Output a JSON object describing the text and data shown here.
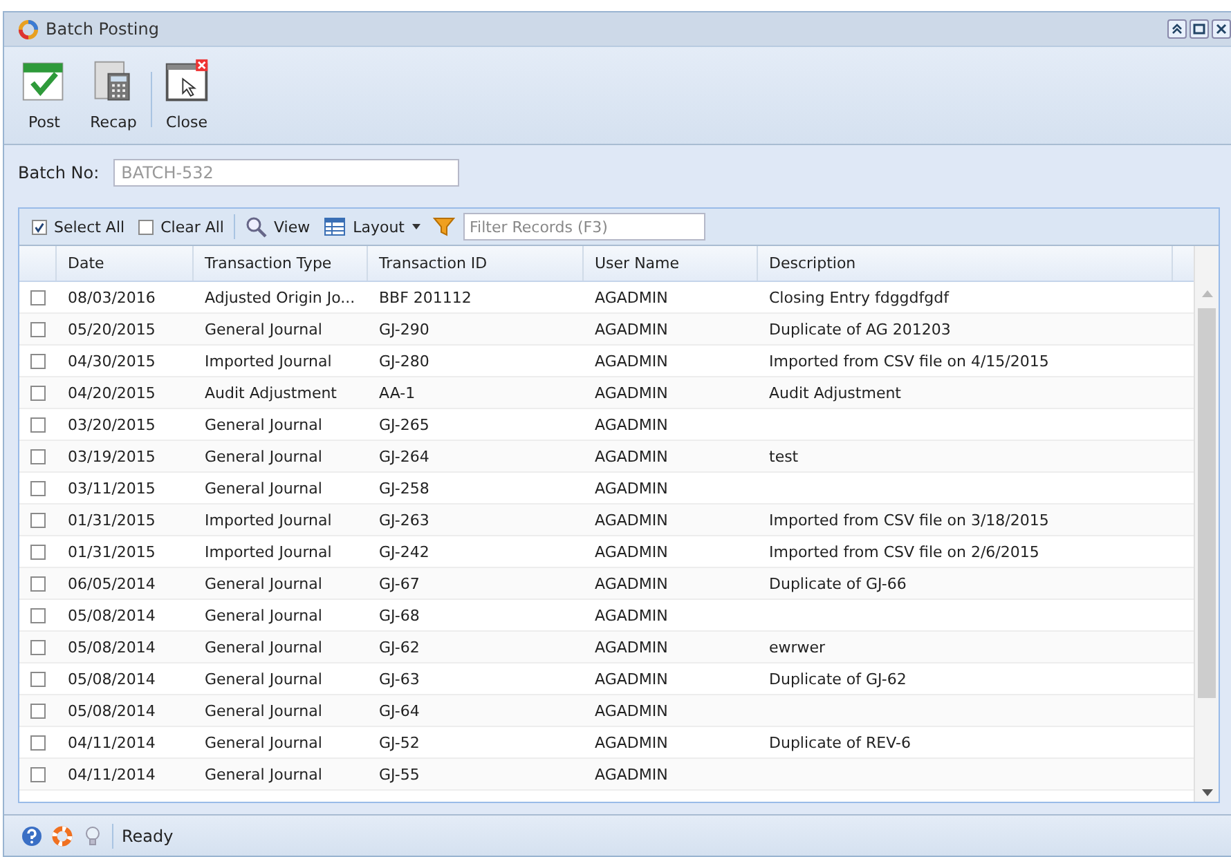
{
  "window": {
    "title": "Batch Posting"
  },
  "toolbar": [
    {
      "label": "Post",
      "kind": "post"
    },
    {
      "label": "Recap",
      "kind": "recap"
    },
    {
      "label": "Close",
      "kind": "close"
    }
  ],
  "batch": {
    "label": "Batch No:",
    "value": "BATCH-532"
  },
  "grid_toolbar": {
    "select_all": {
      "label": "Select All",
      "checked": true
    },
    "clear_all": {
      "label": "Clear All",
      "checked": false
    },
    "view": "View",
    "layout": "Layout",
    "filter": {
      "placeholder": "Filter Records (F3)"
    }
  },
  "table": {
    "columns": [
      "Date",
      "Transaction Type",
      "Transaction ID",
      "User Name",
      "Description"
    ],
    "rows": [
      {
        "checked": false,
        "cells": [
          "08/03/2016",
          "Adjusted Origin Jo...",
          "BBF 201112",
          "AGADMIN",
          "Closing Entry fdggdfgdf"
        ]
      },
      {
        "checked": false,
        "cells": [
          "05/20/2015",
          "General Journal",
          "GJ-290",
          "AGADMIN",
          "Duplicate of AG 201203"
        ]
      },
      {
        "checked": false,
        "cells": [
          "04/30/2015",
          "Imported Journal",
          "GJ-280",
          "AGADMIN",
          "Imported from CSV file on 4/15/2015"
        ]
      },
      {
        "checked": false,
        "cells": [
          "04/20/2015",
          "Audit Adjustment",
          "AA-1",
          "AGADMIN",
          "Audit Adjustment"
        ]
      },
      {
        "checked": false,
        "cells": [
          "03/20/2015",
          "General Journal",
          "GJ-265",
          "AGADMIN",
          ""
        ]
      },
      {
        "checked": false,
        "cells": [
          "03/19/2015",
          "General Journal",
          "GJ-264",
          "AGADMIN",
          "test"
        ]
      },
      {
        "checked": false,
        "cells": [
          "03/11/2015",
          "General Journal",
          "GJ-258",
          "AGADMIN",
          ""
        ]
      },
      {
        "checked": false,
        "cells": [
          "01/31/2015",
          "Imported Journal",
          "GJ-263",
          "AGADMIN",
          "Imported from CSV file on 3/18/2015"
        ]
      },
      {
        "checked": false,
        "cells": [
          "01/31/2015",
          "Imported Journal",
          "GJ-242",
          "AGADMIN",
          "Imported from CSV file on 2/6/2015"
        ]
      },
      {
        "checked": false,
        "cells": [
          "06/05/2014",
          "General Journal",
          "GJ-67",
          "AGADMIN",
          "Duplicate of GJ-66"
        ]
      },
      {
        "checked": false,
        "cells": [
          "05/08/2014",
          "General Journal",
          "GJ-68",
          "AGADMIN",
          ""
        ]
      },
      {
        "checked": false,
        "cells": [
          "05/08/2014",
          "General Journal",
          "GJ-62",
          "AGADMIN",
          "ewrwer"
        ]
      },
      {
        "checked": false,
        "cells": [
          "05/08/2014",
          "General Journal",
          "GJ-63",
          "AGADMIN",
          "Duplicate of GJ-62"
        ]
      },
      {
        "checked": false,
        "cells": [
          "05/08/2014",
          "General Journal",
          "GJ-64",
          "AGADMIN",
          ""
        ]
      },
      {
        "checked": false,
        "cells": [
          "04/11/2014",
          "General Journal",
          "GJ-52",
          "AGADMIN",
          "Duplicate of REV-6"
        ]
      },
      {
        "checked": false,
        "cells": [
          "04/11/2014",
          "General Journal",
          "GJ-55",
          "AGADMIN",
          ""
        ]
      }
    ]
  },
  "status_bar": {
    "text": "Ready"
  }
}
